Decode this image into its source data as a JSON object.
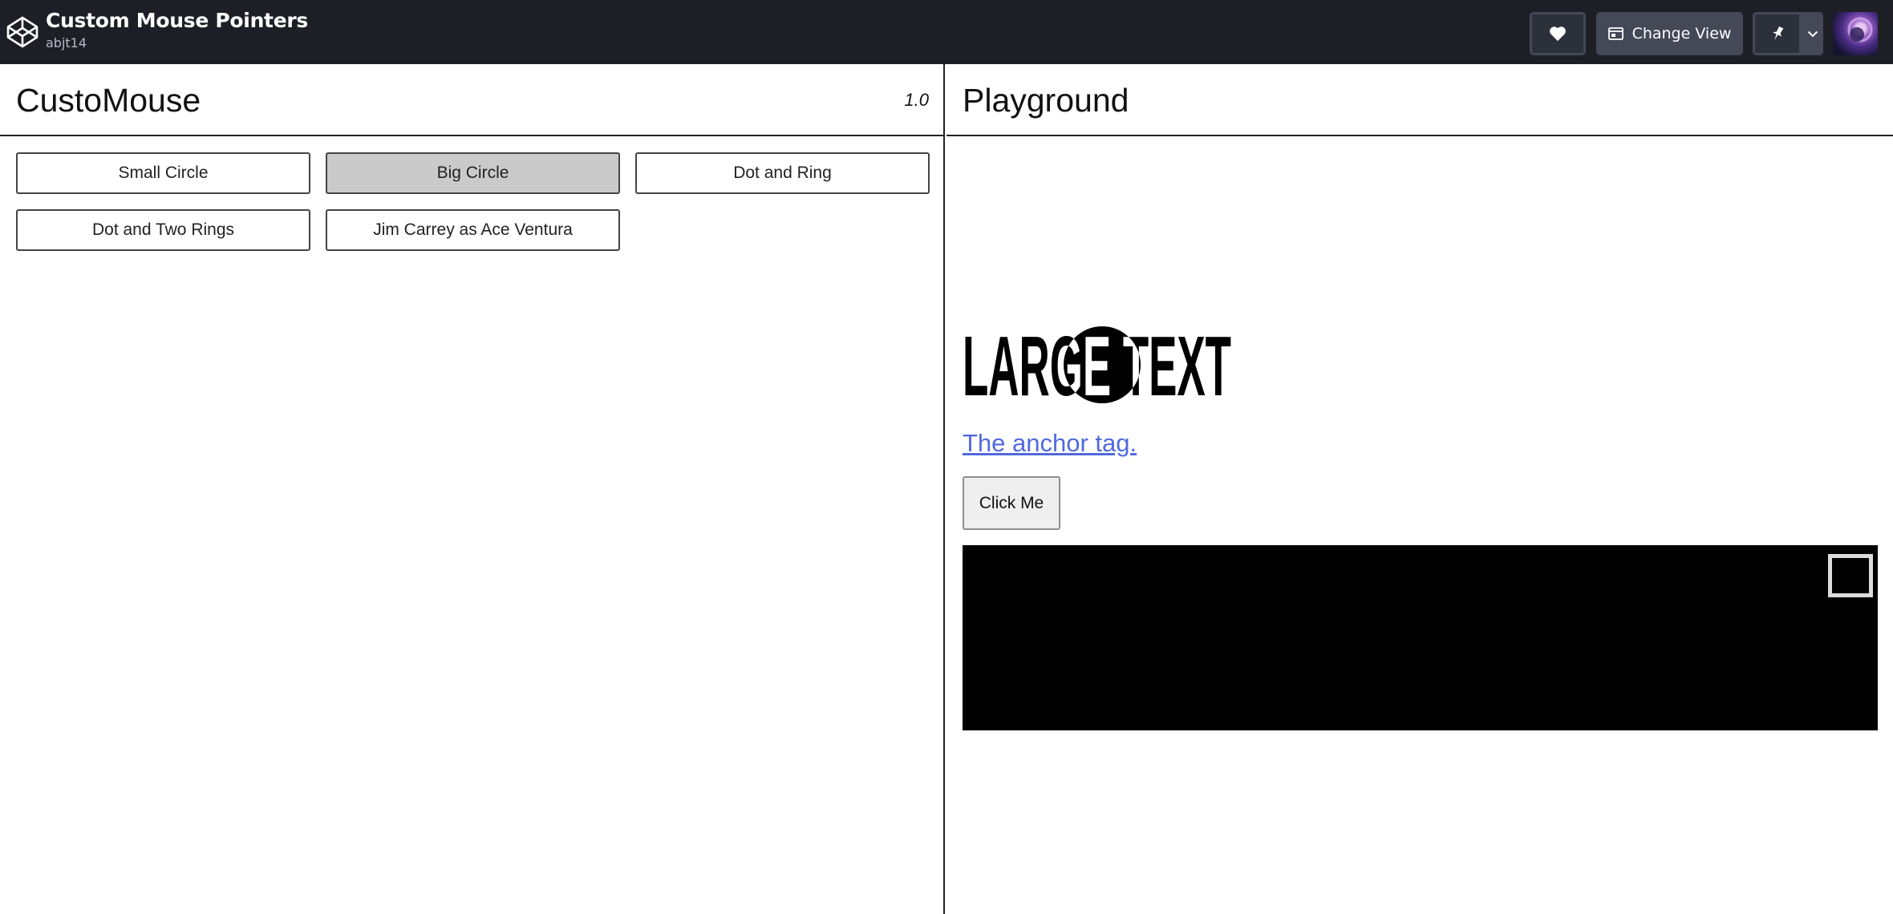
{
  "header": {
    "pen_title": "Custom Mouse Pointers",
    "author": "abjt14",
    "change_view_label": "Change View",
    "logo_icon": "codepen-cube-icon",
    "heart_icon": "heart-icon",
    "view_icon": "change-view-icon",
    "pin_icon": "pin-icon",
    "caret_icon": "chevron-down-icon"
  },
  "left_panel": {
    "title": "CustoMouse",
    "version": "1.0",
    "buttons": [
      {
        "label": "Small Circle",
        "selected": false
      },
      {
        "label": "Big Circle",
        "selected": true
      },
      {
        "label": "Dot and Ring",
        "selected": false
      },
      {
        "label": "Dot and Two Rings",
        "selected": false
      },
      {
        "label": "Jim Carrey as Ace Ventura",
        "selected": false
      }
    ]
  },
  "playground": {
    "title": "Playground",
    "large_text": "LARGE TEXT",
    "anchor_text": "The anchor tag.",
    "click_button": "Click Me"
  },
  "colors": {
    "header_bg": "#1e1f26",
    "selected_button_bg": "#cacaca",
    "link": "#5169dd",
    "black_box": "#000000"
  }
}
